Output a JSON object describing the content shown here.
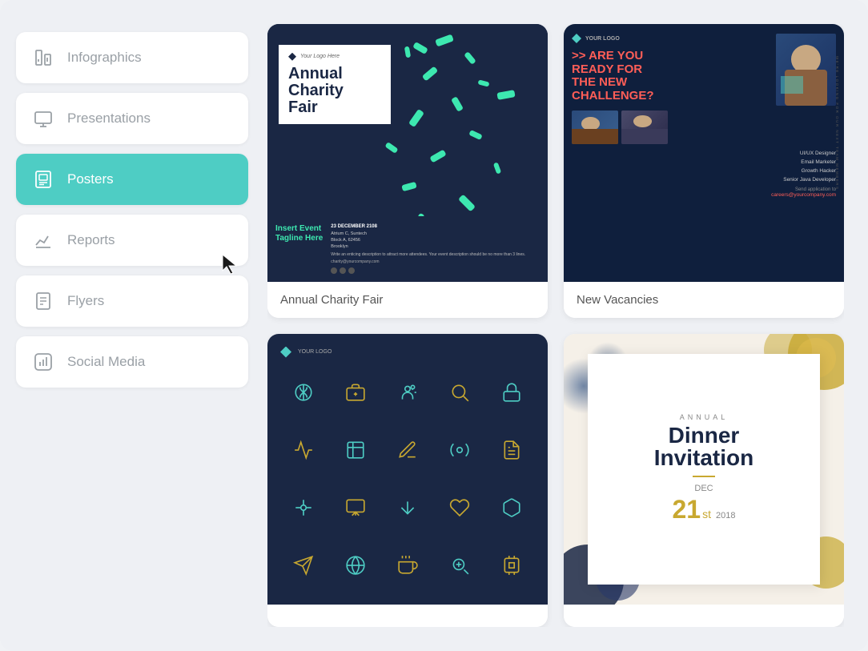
{
  "sidebar": {
    "items": [
      {
        "id": "infographics",
        "label": "Infographics",
        "active": false
      },
      {
        "id": "presentations",
        "label": "Presentations",
        "active": false
      },
      {
        "id": "posters",
        "label": "Posters",
        "active": true
      },
      {
        "id": "reports",
        "label": "Reports",
        "active": false
      },
      {
        "id": "flyers",
        "label": "Flyers",
        "active": false
      },
      {
        "id": "social-media",
        "label": "Social Media",
        "active": false
      }
    ]
  },
  "cards": [
    {
      "id": "charity-fair",
      "label": "Annual Charity Fair"
    },
    {
      "id": "new-vacancies",
      "label": "New Vacancies"
    },
    {
      "id": "tech-icons",
      "label": ""
    },
    {
      "id": "dinner-invitation",
      "label": ""
    }
  ],
  "charity": {
    "logo_text": "Your Logo Here",
    "title_line1": "Annual",
    "title_line2": "Charity",
    "title_line3": "Fair",
    "tagline": "Insert Event\nTagline Here",
    "date": "23 DECEMBER 2108",
    "venue1": "Atrium C, Suntech",
    "venue2": "Block A, 62456",
    "venue3": "Brooklyn",
    "description": "Write an enticing description to attract more attendees. Your event description should be no more than 3 lines.",
    "email": "charity@yourcompany.com"
  },
  "vacancies": {
    "logo_text": "YOUR LOGO",
    "headline_line1": ">> ARE YOU",
    "headline_line2": "READY FOR",
    "headline_line3": "THE NEW",
    "headline_line4": "CHALLENGE?",
    "looking_text": "WE'RE LOOKING FOR OUR NEXT TEAM MEMBERS",
    "roles": [
      "UI/UX Designer",
      "Email Marketer",
      "Growth Hacker",
      "Senior Java Developer"
    ],
    "send_text": "Send application to",
    "email": "careers@yourcompany.com"
  },
  "dinner": {
    "annual": "ANNUAL",
    "title_line1": "Dinner",
    "title_line2": "Invitation",
    "dec": "DEC",
    "date_num": "21",
    "date_sup": "st",
    "year": "2018"
  }
}
